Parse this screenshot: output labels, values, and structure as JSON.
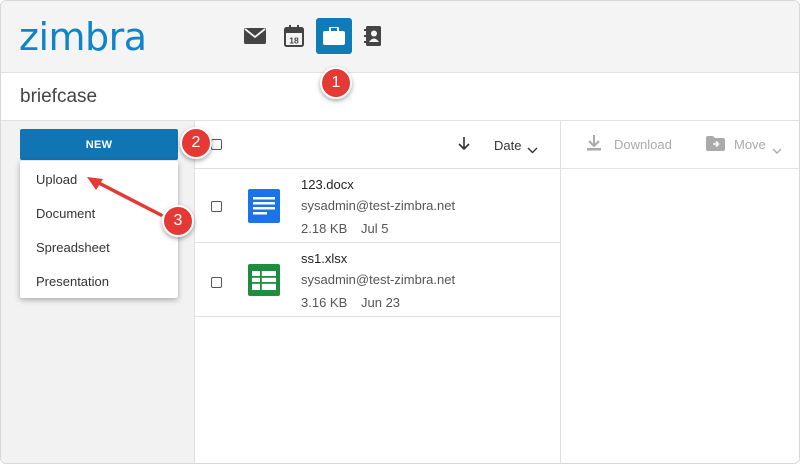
{
  "app": {
    "logo_text": "zimbra",
    "brand_color": "#0f85c8",
    "nav_icons": [
      {
        "name": "mail-icon",
        "active": false
      },
      {
        "name": "calendar-icon",
        "day": "18",
        "active": false
      },
      {
        "name": "briefcase-icon",
        "active": true
      },
      {
        "name": "contacts-icon",
        "active": false
      }
    ]
  },
  "page": {
    "title": "briefcase"
  },
  "sidebar": {
    "new_label": "NEW",
    "menu_items": [
      "Upload",
      "Document",
      "Spreadsheet",
      "Presentation"
    ]
  },
  "list": {
    "sort_label": "Date",
    "files": [
      {
        "name": "123.docx",
        "owner": "sysadmin@test-zimbra.net",
        "size": "2.18 KB",
        "date": "Jul 5",
        "icon": "document-icon",
        "color": "#1a73e8"
      },
      {
        "name": "ss1.xlsx",
        "owner": "sysadmin@test-zimbra.net",
        "size": "3.16 KB",
        "date": "Jun 23",
        "icon": "spreadsheet-icon",
        "color": "#1e8e3e"
      }
    ]
  },
  "actions": {
    "download_label": "Download",
    "move_label": "Move"
  },
  "callouts": [
    "1",
    "2",
    "3"
  ],
  "callout_color": "#e53935"
}
